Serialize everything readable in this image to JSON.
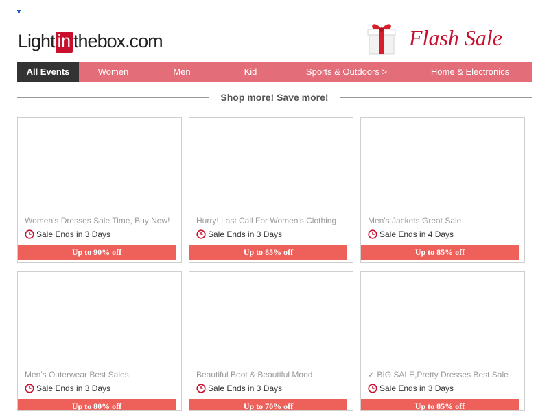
{
  "brand": {
    "logo_left": "Light",
    "logo_mid": "in",
    "logo_right": "thebox.com",
    "brand_red": "#c8102e"
  },
  "promo": {
    "flash_label": "Flash Sale",
    "icon": "gift-icon"
  },
  "nav": {
    "items": [
      {
        "label": "All Events",
        "active": true
      },
      {
        "label": "Women"
      },
      {
        "label": "Men"
      },
      {
        "label": "Kid"
      },
      {
        "label": "Sports & Outdoors >"
      },
      {
        "label": "Home & Electronics"
      }
    ],
    "bar_color": "#e46d7a",
    "active_color": "#333333"
  },
  "tagline": "Shop more! Save more!",
  "cards": [
    {
      "title": "Women's Dresses Sale Time, Buy Now!",
      "ends": "Sale Ends in 3 Days",
      "offer": "Up to 90% off"
    },
    {
      "title": "Hurry! Last Call For Women's Clothing",
      "ends": "Sale Ends in 3 Days",
      "offer": "Up to 85% off"
    },
    {
      "title": "Men's Jackets Great Sale",
      "ends": "Sale Ends in 4 Days",
      "offer": "Up to 85% off"
    },
    {
      "title": "Men's Outerwear Best Sales",
      "ends": "Sale Ends in 3 Days",
      "offer": "Up to 80% off"
    },
    {
      "title": "Beautiful Boot & Beautiful Mood",
      "ends": "Sale Ends in 3 Days",
      "offer": "Up to 70% off"
    },
    {
      "title": "✓ BIG SALE,Pretty Dresses Best Sale",
      "ends": "Sale Ends in 3 Days",
      "offer": "Up to 85% off"
    }
  ],
  "offer_color": "#ee615b"
}
